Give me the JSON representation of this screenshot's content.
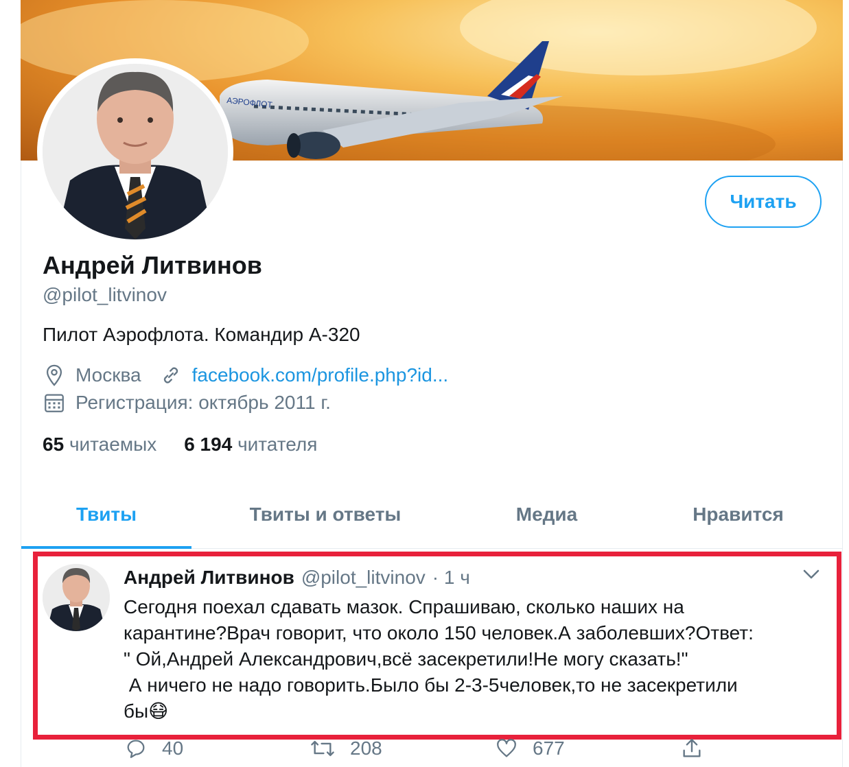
{
  "profile": {
    "name": "Андрей Литвинов",
    "handle": "@pilot_litvinov",
    "bio": "Пилот Аэрофлота. Командир А-320",
    "location": "Москва",
    "link": "facebook.com/profile.php?id...",
    "joined": "Регистрация: октябрь 2011 г.",
    "following_count": "65",
    "following_label": "читаемых",
    "followers_count": "6 194",
    "followers_label": "читателя",
    "follow_button": "Читать"
  },
  "tabs": [
    {
      "label": "Твиты",
      "active": true
    },
    {
      "label": "Твиты и ответы",
      "active": false
    },
    {
      "label": "Медиа",
      "active": false
    },
    {
      "label": "Нравится",
      "active": false
    }
  ],
  "tweet": {
    "author": "Андрей Литвинов",
    "handle": "@pilot_litvinov",
    "time": "· 1 ч",
    "text": "Сегодня поехал сдавать мазок. Спрашиваю, сколько наших на\nкарантине?Врач говорит, что около 150 человек.А заболевших?Ответ:\n\" Ой,Андрей Александрович,всё засекретили!Не могу сказать!\"\n А ничего не надо говорить.Было бы 2-3-5человек,то не засекретили\nбы😷",
    "replies": "40",
    "retweets": "208",
    "likes": "677"
  },
  "colors": {
    "accent": "#1da1f2",
    "highlight_border": "#e8213b",
    "secondary_text": "#657786"
  },
  "icons": {
    "location": "location-pin-icon",
    "link": "link-icon",
    "calendar": "calendar-icon",
    "reply": "reply-icon",
    "retweet": "retweet-icon",
    "like": "heart-icon",
    "share": "share-icon",
    "caret": "chevron-down-icon"
  }
}
